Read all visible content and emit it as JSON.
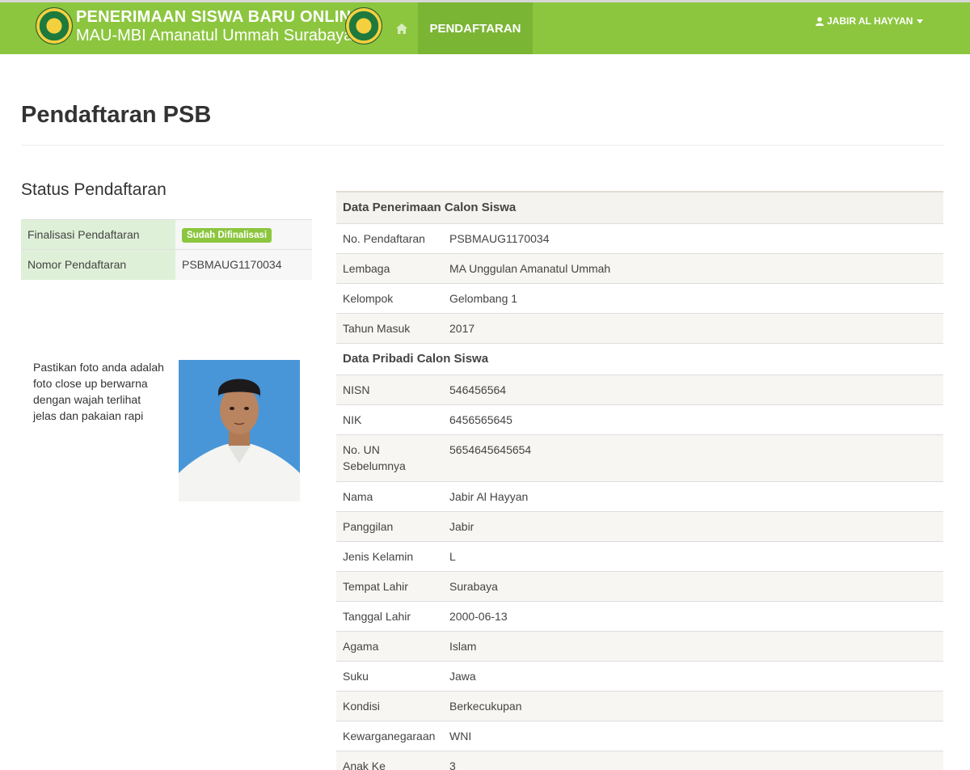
{
  "nav": {
    "brand_line1": "PENERIMAAN SISWA BARU ONLINE",
    "brand_line2": "MAU-MBI Amanatul Ummah Surabaya",
    "active_label": "PENDAFTARAN",
    "user_name": "JABIR AL HAYYAN"
  },
  "page": {
    "title": "Pendaftaran PSB"
  },
  "status": {
    "heading": "Status Pendaftaran",
    "rows": [
      {
        "label": "Finalisasi Pendaftaran",
        "value": "Sudah Difinalisasi"
      },
      {
        "label": "Nomor Pendaftaran",
        "value": "PSBMAUG1170034"
      }
    ]
  },
  "photo_note": "Pastikan foto anda adalah foto close up berwarna dengan wajah terlihat jelas dan pakaian rapi",
  "data": {
    "section1_title": "Data Penerimaan Calon Siswa",
    "section1": [
      {
        "label": "No. Pendaftaran",
        "value": "PSBMAUG1170034"
      },
      {
        "label": "Lembaga",
        "value": "MA Unggulan Amanatul Ummah"
      },
      {
        "label": "Kelompok",
        "value": "Gelombang 1"
      },
      {
        "label": "Tahun Masuk",
        "value": "2017"
      }
    ],
    "section2_title": "Data Pribadi Calon Siswa",
    "section2": [
      {
        "label": "NISN",
        "value": "546456564"
      },
      {
        "label": "NIK",
        "value": "6456565645"
      },
      {
        "label": "No. UN Sebelumnya",
        "value": "5654645645654"
      },
      {
        "label": "Nama",
        "value": "Jabir Al Hayyan"
      },
      {
        "label": "Panggilan",
        "value": "Jabir"
      },
      {
        "label": "Jenis Kelamin",
        "value": "L"
      },
      {
        "label": "Tempat Lahir",
        "value": "Surabaya"
      },
      {
        "label": "Tanggal Lahir",
        "value": "2000-06-13"
      },
      {
        "label": "Agama",
        "value": "Islam"
      },
      {
        "label": "Suku",
        "value": "Jawa"
      },
      {
        "label": "Kondisi",
        "value": "Berkecukupan"
      },
      {
        "label": "Kewarganegaraan",
        "value": "WNI"
      },
      {
        "label": "Anak Ke",
        "value": "3"
      }
    ]
  },
  "colors": {
    "navbar": "#8cc63f",
    "nav_active": "#7bb534",
    "status_label_bg": "#dff0d8",
    "badge": "#8cc63f"
  },
  "icons": {
    "home": "home-icon",
    "user": "user-icon",
    "caret": "caret-down-icon"
  }
}
